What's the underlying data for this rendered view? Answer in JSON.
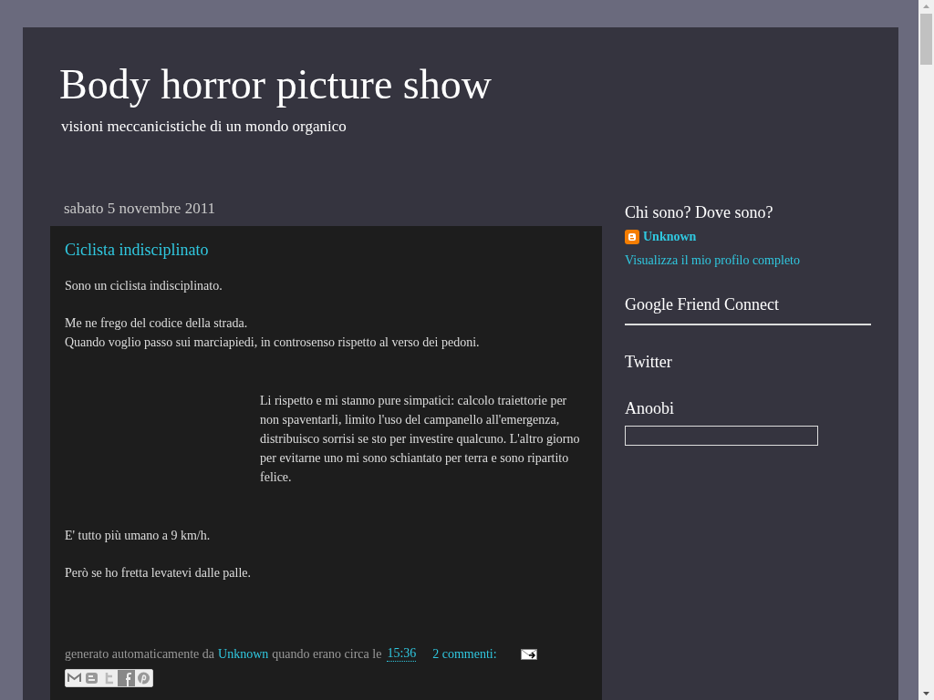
{
  "header": {
    "title": "Body horror picture show",
    "description": "visioni meccanicistiche di un mondo organico"
  },
  "post": {
    "date": "sabato 5 novembre 2011",
    "title": "Ciclista indisciplinato",
    "paragraphs": [
      {
        "kind": "plain",
        "text": "Sono un ciclista indisciplinato."
      },
      {
        "kind": "plain",
        "text": "Me ne frego del codice della strada.\nQuando voglio passo sui marciapiedi, in controsenso rispetto al verso dei pedoni."
      },
      {
        "kind": "offset",
        "text": "Li rispetto e mi stanno pure simpatici: calcolo traiettorie per non spaventarli, limito l'uso del campanello all'emergenza, distribuisco sorrisi se sto per investire qualcuno. L'altro giorno per evitarne uno mi sono schiantato per terra e sono ripartito felice."
      },
      {
        "kind": "plain",
        "text": "E' tutto più umano a 9 km/h."
      },
      {
        "kind": "plain",
        "text": "Però se ho fretta levatevi dalle palle."
      }
    ],
    "footer": {
      "prefix": "generato automaticamente da",
      "author": "Unknown",
      "middle": "quando erano circa le",
      "time": "15:36",
      "comments": "2 commenti:"
    }
  },
  "sidebar": {
    "profile": {
      "heading": "Chi sono? Dove sono?",
      "name": "Unknown",
      "link": "Visualizza il mio profilo completo"
    },
    "widgets": [
      {
        "title": "Google Friend Connect",
        "kind": "rule"
      },
      {
        "title": "Twitter",
        "kind": "plain"
      },
      {
        "title": "Anoobi",
        "kind": "box"
      }
    ]
  }
}
